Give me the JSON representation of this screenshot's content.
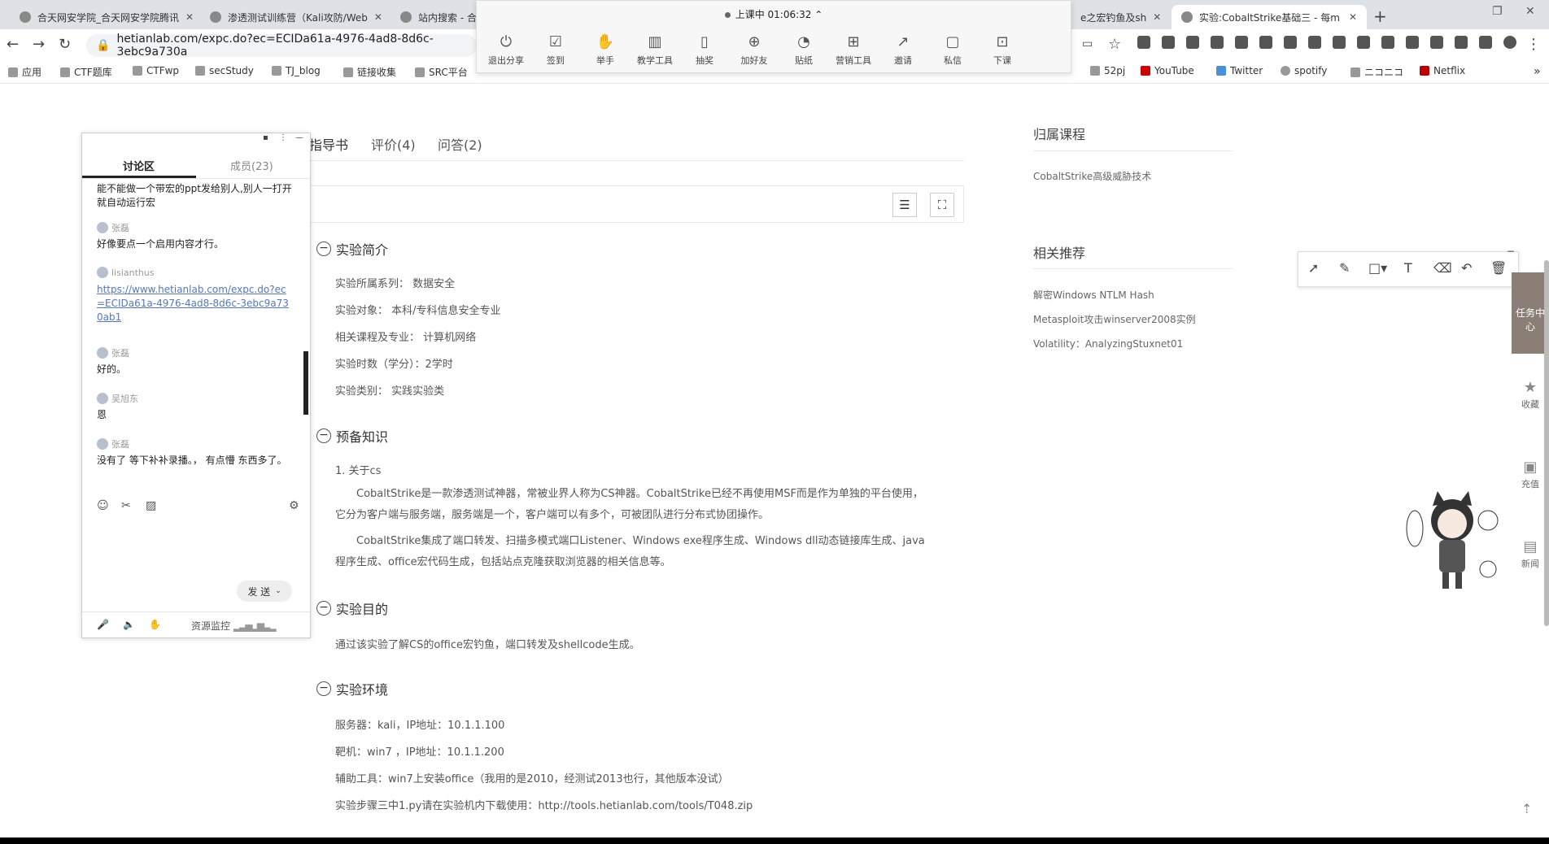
{
  "browser": {
    "tabs": [
      {
        "title": "合天网安学院_合天网安学院腾讯"
      },
      {
        "title": "渗透测试训练营（Kali攻防/Web"
      },
      {
        "title": "站内搜索 - 合"
      },
      {
        "title": "e之宏钓鱼及sh"
      },
      {
        "title": "实验:CobaltStrike基础三 - 每m"
      }
    ],
    "url": "hetianlab.com/expc.do?ec=ECIDa61a-4976-4ad8-8d6c-3ebc9a730a",
    "bookmarks": [
      "应用",
      "CTF题库",
      "CTFwp",
      "secStudy",
      "TJ_blog",
      "链接收集",
      "SRC平台",
      "52pj",
      "YouTube",
      "Twitter",
      "spotify",
      "ニコニコ",
      "Netflix"
    ]
  },
  "live": {
    "status": "上课中 01:06:32",
    "tools": [
      {
        "icon": "exit-share-icon",
        "label": "退出分享"
      },
      {
        "icon": "checkin-icon",
        "label": "签到"
      },
      {
        "icon": "raise-hand-icon",
        "label": "举手"
      },
      {
        "icon": "teaching-tools-icon",
        "label": "教学工具"
      },
      {
        "icon": "lottery-icon",
        "label": "抽奖"
      },
      {
        "icon": "add-friend-icon",
        "label": "加好友"
      },
      {
        "icon": "sticker-icon",
        "label": "贴纸"
      },
      {
        "icon": "marketing-tools-icon",
        "label": "营销工具"
      },
      {
        "icon": "invite-icon",
        "label": "邀请"
      },
      {
        "icon": "private-message-icon",
        "label": "私信"
      },
      {
        "icon": "end-class-icon",
        "label": "下课"
      }
    ]
  },
  "page": {
    "tabs": [
      "指导书",
      "评价(4)",
      "问答(2)"
    ],
    "sections": {
      "intro_title": "实验简介",
      "intro_lines": [
        "实验所属系列： 数据安全",
        "实验对象： 本科/专科信息安全专业",
        "相关课程及专业： 计算机网络",
        "实验时数（学分）：2学时",
        "实验类别： 实践实验类"
      ],
      "prep_title": "预备知识",
      "prep_sub": "1. 关于cs",
      "prep_p1": "CobaltStrike是一款渗透测试神器，常被业界人称为CS神器。CobaltStrike已经不再使用MSF而是作为单独的平台使用，它分为客户端与服务端，服务端是一个，客户端可以有多个，可被团队进行分布式协团操作。",
      "prep_p2": "CobaltStrike集成了端口转发、扫描多模式端口Listener、Windows exe程序生成、Windows dll动态链接库生成、java程序生成、office宏代码生成，包括站点克隆获取浏览器的相关信息等。",
      "goal_title": "实验目的",
      "goal_text": "通过该实验了解CS的office宏钓鱼，端口转发及shellcode生成。",
      "env_title": "实验环境",
      "env_lines": [
        "服务器：kali，IP地址：10.1.1.100",
        "靶机：win7 ，IP地址：10.1.1.200",
        "辅助工具：win7上安装office（我用的是2010，经测试2013也行，其他版本没试）",
        "实验步骤三中1.py请在实验机内下载使用：http://tools.hetianlab.com/tools/T048.zip"
      ]
    },
    "right": {
      "course_title": "归属课程",
      "course_link": "CobaltStrike高级威胁技术",
      "recommend_title": "相关推荐",
      "recommend_links": [
        "解密Windows NTLM Hash",
        "Metasploit攻击winserver2008实例",
        "Volatility：AnalyzingStuxnet01"
      ]
    },
    "side": {
      "task_center": "任务中心",
      "items": [
        {
          "icon": "star-icon",
          "label": "收藏"
        },
        {
          "icon": "recharge-icon",
          "label": "充值"
        },
        {
          "icon": "news-icon",
          "label": "新闻"
        }
      ]
    }
  },
  "chat": {
    "tab_discussion": "讨论区",
    "tab_members": "成员(23)",
    "messages": [
      {
        "sender": "",
        "text": "能不能做一个带宏的ppt发给别人,别人一打开就自动运行宏"
      },
      {
        "sender": "张磊",
        "text": "好像要点一个启用内容才行。"
      },
      {
        "sender": "lisianthus",
        "text": "https://www.hetianlab.com/expc.do?ec=ECIDa61a-4976-4ad8-8d6c-3ebc9a730ab1"
      },
      {
        "sender": "张磊",
        "text": "好的。"
      },
      {
        "sender": "吴旭东",
        "text": "恩"
      },
      {
        "sender": "张磊",
        "text": "没有了 等下补补录播。， 有点懵 东西多了。"
      }
    ],
    "send_label": "发 送",
    "monitor_label": "资源监控"
  },
  "colors": {
    "accent": "#8a7e76",
    "link": "#5577bb"
  }
}
